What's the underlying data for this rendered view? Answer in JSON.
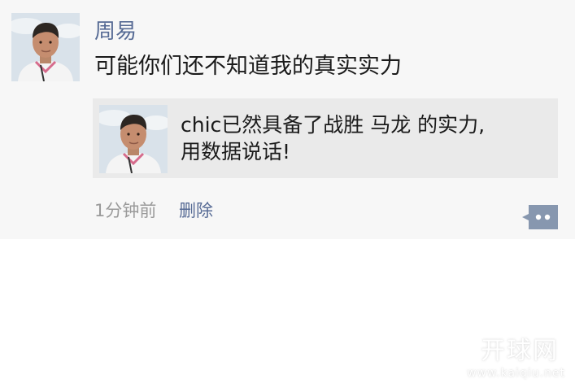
{
  "post": {
    "author": "周易",
    "text": "可能你们还不知道我的真实实力",
    "time": "1分钟前",
    "delete_label": "删除"
  },
  "shared_link": {
    "title_line1": "chic已然具备了战胜 马龙 的实力,",
    "title_line2": "用数据说话!"
  },
  "icons": {
    "comment": "comment-icon",
    "avatar": "user-avatar"
  },
  "watermark": {
    "title": "开球网",
    "url": "www.kaiqiu.net"
  },
  "colors": {
    "author_link": "#576b95",
    "background": "#f7f7f7",
    "card_background": "#eaeaea",
    "comment_button": "#8797af"
  }
}
